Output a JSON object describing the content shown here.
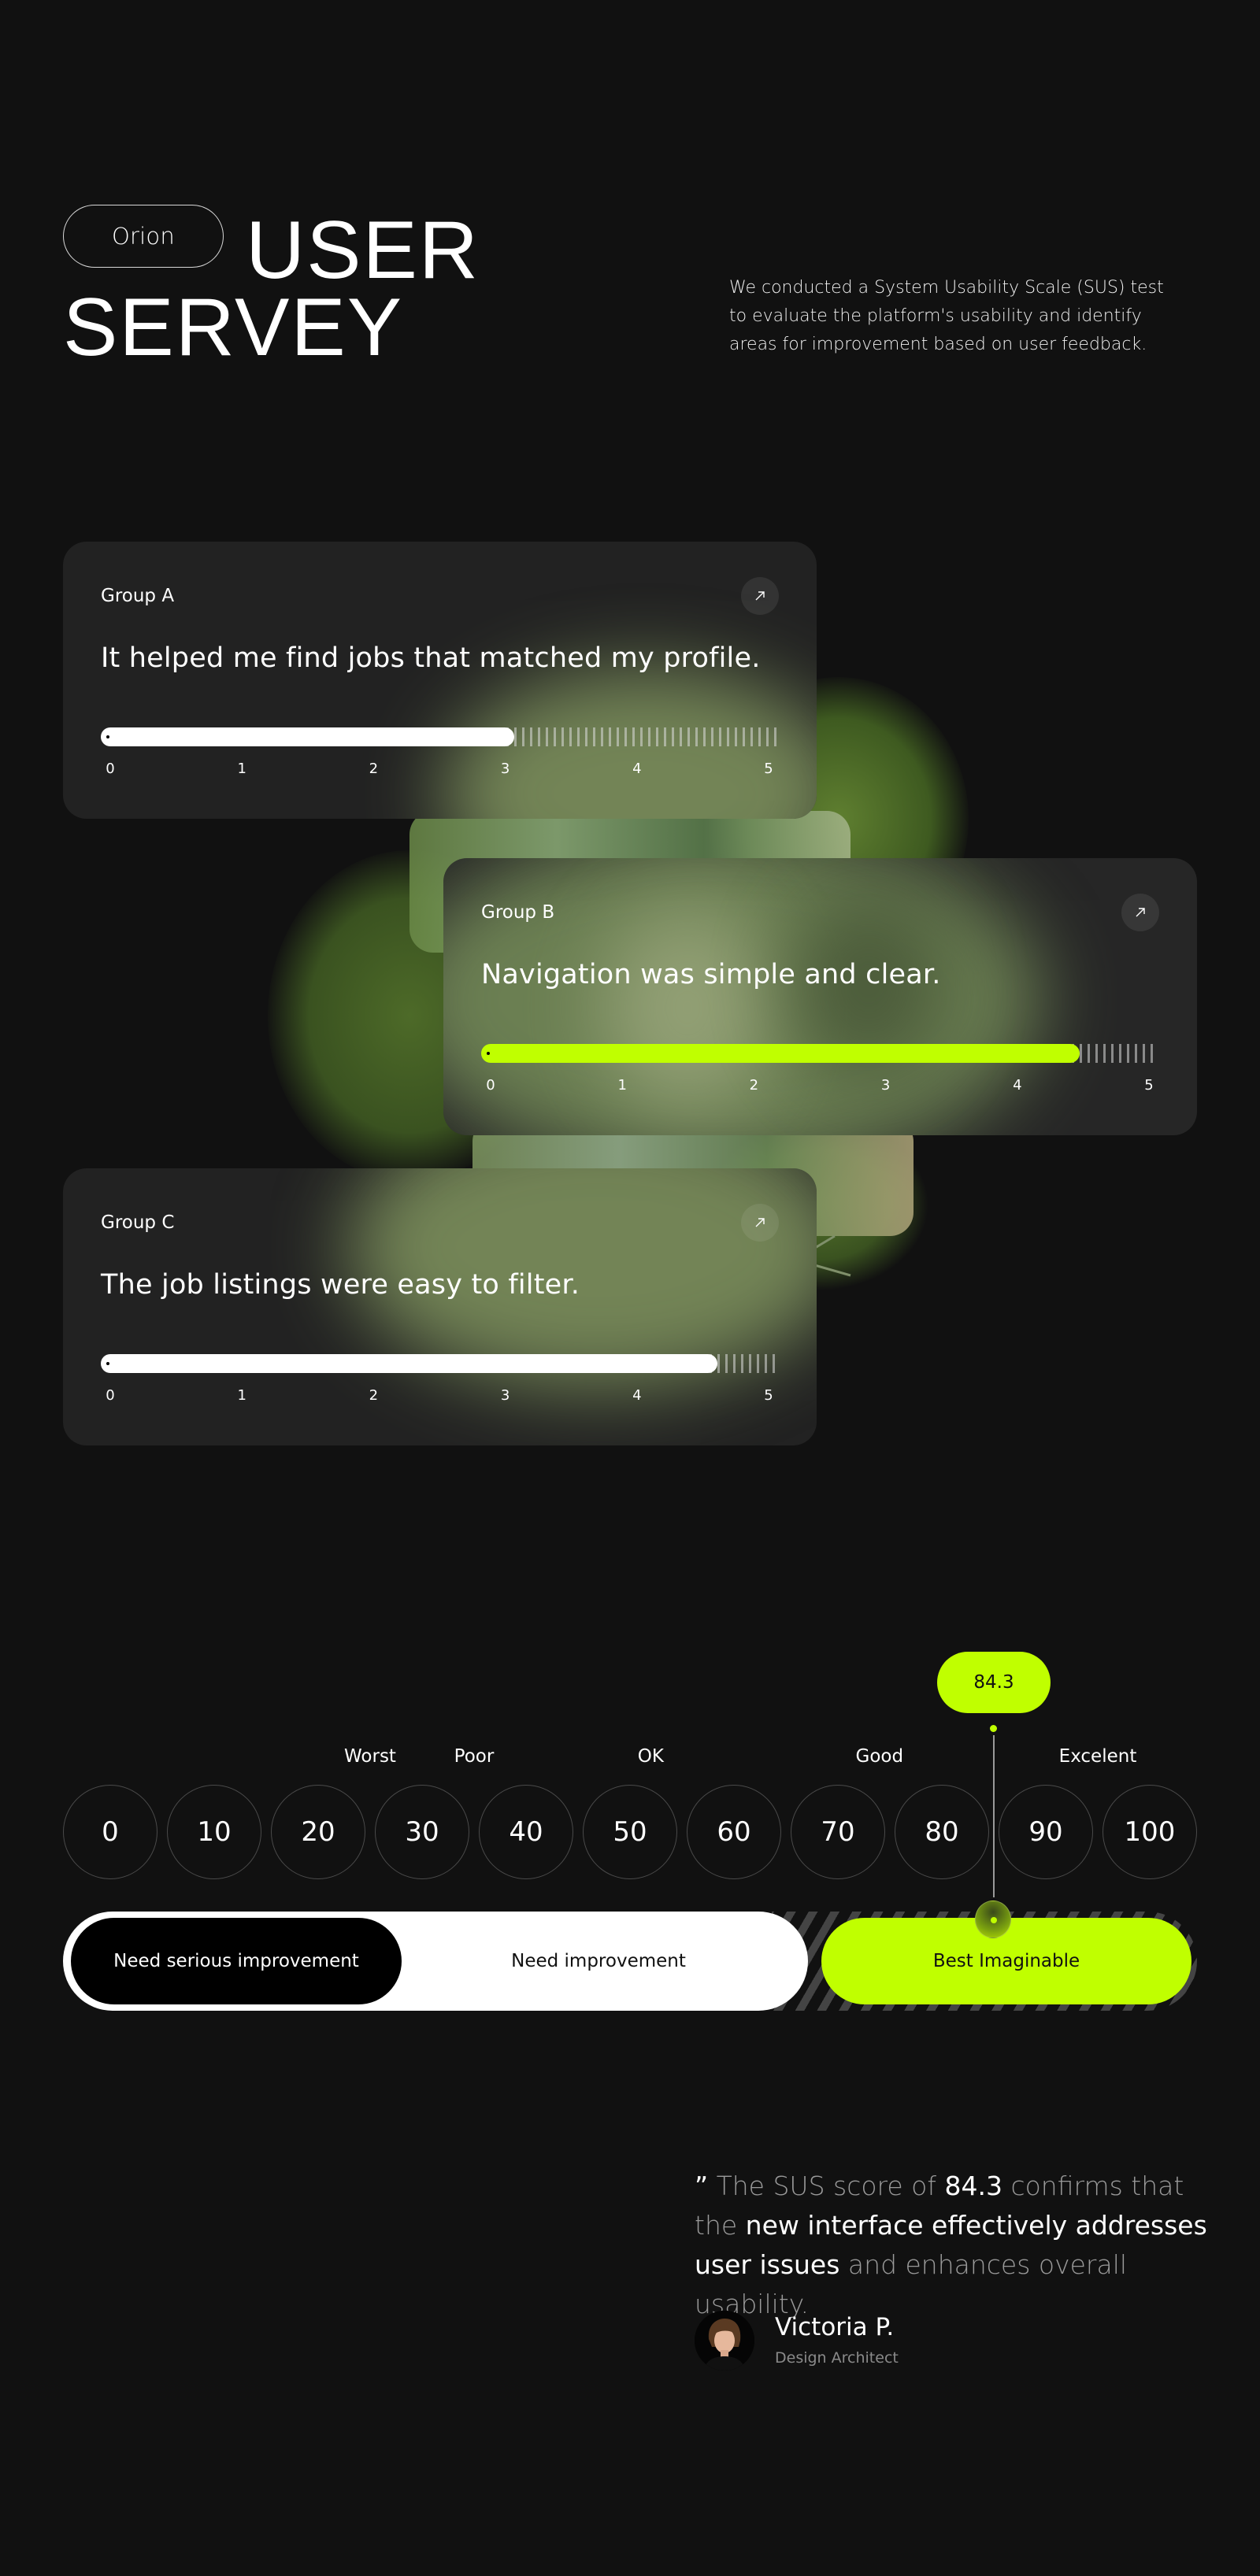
{
  "header": {
    "brand": "Orion",
    "title_line1": "USER",
    "title_line2": "SERVEY",
    "intro": "We conducted a System Usability Scale (SUS) test to evaluate the platform's usability and identify areas for improvement based on user feedback."
  },
  "cards": [
    {
      "group": "Group A",
      "statement": "It helped me find jobs that matched my profile.",
      "rating": 3.05,
      "rating_max": 5,
      "fill_color": "#ffffff",
      "scale": [
        "0",
        "1",
        "2",
        "3",
        "4",
        "5"
      ],
      "icon": "arrow-up-right-icon"
    },
    {
      "group": "Group B",
      "statement": "Navigation was simple and clear.",
      "rating": 4.42,
      "rating_max": 5,
      "fill_color": "#c0ff00",
      "scale": [
        "0",
        "1",
        "2",
        "3",
        "4",
        "5"
      ],
      "icon": "arrow-up-right-icon"
    },
    {
      "group": "Group C",
      "statement": "The job listings were easy to filter.",
      "rating": 4.55,
      "rating_max": 5,
      "fill_color": "#ffffff",
      "scale": [
        "0",
        "1",
        "2",
        "3",
        "4",
        "5"
      ],
      "icon": "arrow-up-right-icon"
    }
  ],
  "sus": {
    "score": "84.3",
    "score_value": 84.3,
    "bands": [
      {
        "label": "Worst",
        "at": 25
      },
      {
        "label": "Poor",
        "at": 35
      },
      {
        "label": "OK",
        "at": 52
      },
      {
        "label": "Good",
        "at": 74
      },
      {
        "label": "Excelent",
        "at": 95
      }
    ],
    "numbers": [
      "0",
      "10",
      "20",
      "30",
      "40",
      "50",
      "60",
      "70",
      "80",
      "90",
      "100"
    ],
    "ranges": {
      "serious": "Need serious improvement",
      "need": "Need improvement",
      "best": "Best Imaginable"
    }
  },
  "quote": {
    "open_mark": "”",
    "part1": " The SUS score of ",
    "hl1": "84.3",
    "part2": " confirms that the ",
    "hl2": "new interface effectively addresses user issues",
    "part3": " and enhances overall usability.",
    "author": "Victoria P.",
    "role": "Design Architect"
  },
  "colors": {
    "background": "#111111",
    "card": "#222222",
    "accent": "#c0ff00"
  }
}
